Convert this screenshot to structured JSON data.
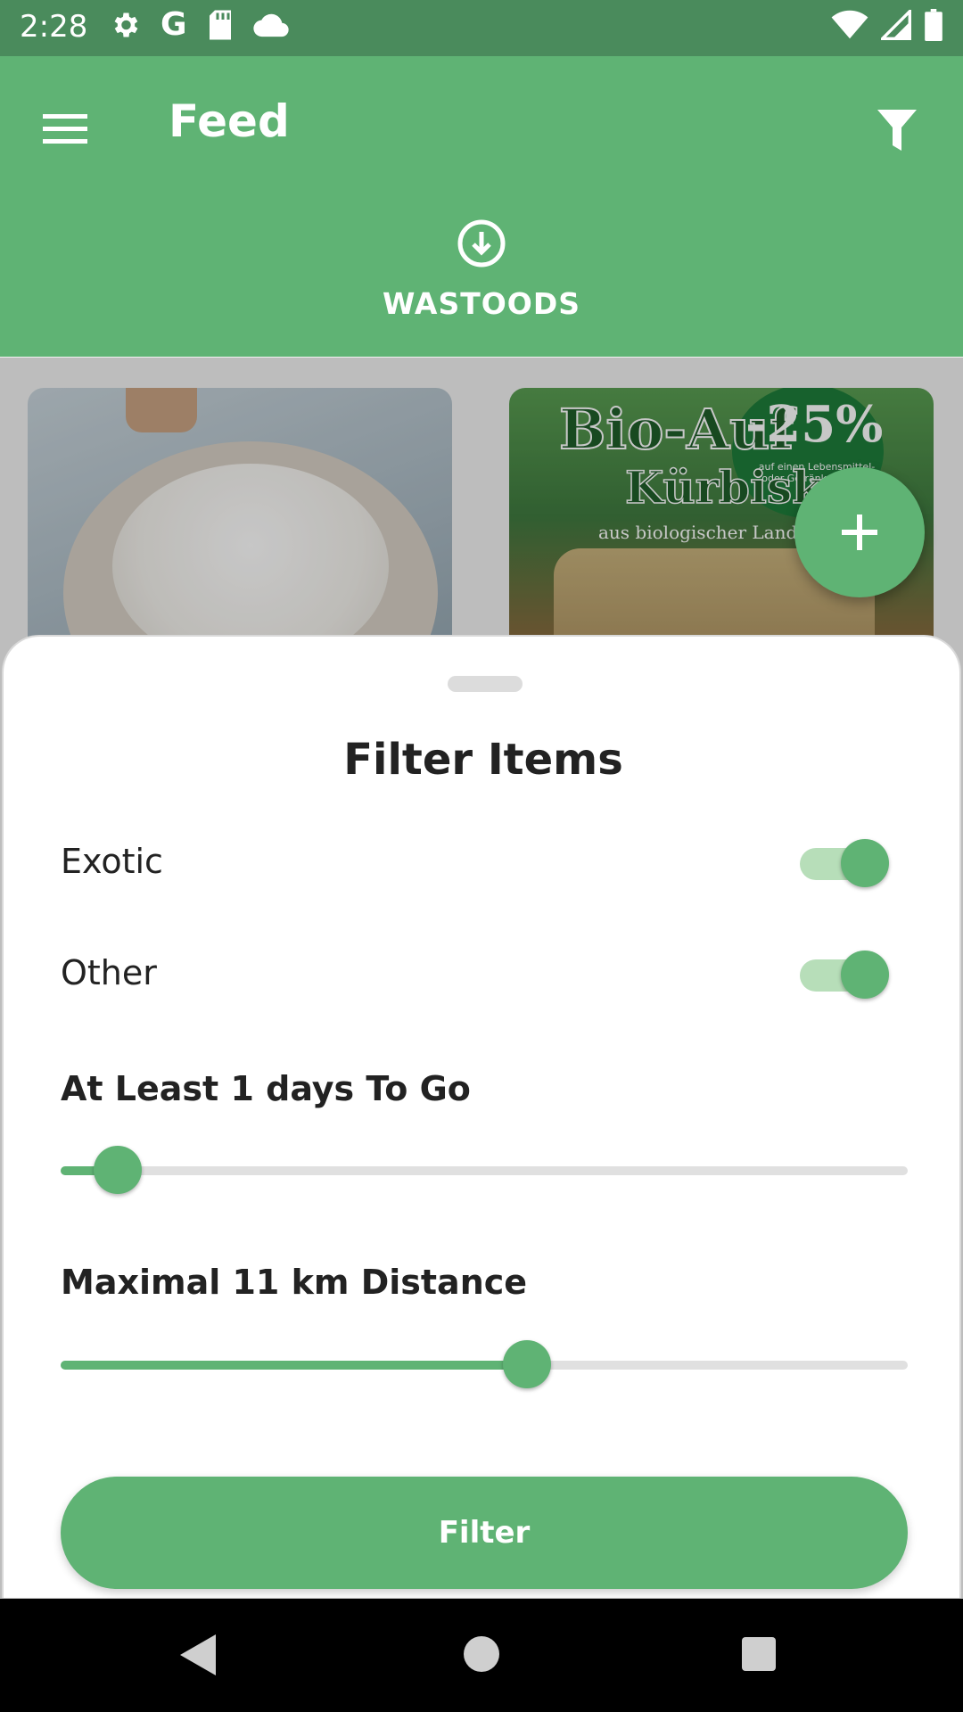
{
  "status_bar": {
    "time": "2:28",
    "google_letter": "G"
  },
  "app_bar": {
    "title": "Feed"
  },
  "tabs": [
    {
      "label": "WASTOODS"
    }
  ],
  "feed": {
    "seed_card": {
      "brand": "Bio-Auf",
      "product": "Kürbisker",
      "subtitle": "aus biologischer Landwirts",
      "badge": "-25%",
      "badge_fine": "auf einen Lebensmittel- oder Getränke-Artikel*"
    }
  },
  "filter_sheet": {
    "title": "Filter Items",
    "toggles": [
      {
        "label": "Exotic",
        "on": true
      },
      {
        "label": "Other",
        "on": true
      }
    ],
    "days_slider": {
      "label": "At Least 1 days To Go",
      "fraction": 0.067
    },
    "distance_slider": {
      "label": "Maximal  11 km Distance",
      "fraction": 0.55
    },
    "submit_label": "Filter"
  },
  "colors": {
    "primary": "#5fb374",
    "status_bar": "#4a8b5c",
    "track": "#e0e0e0",
    "switch_track": "#b7deb9"
  }
}
